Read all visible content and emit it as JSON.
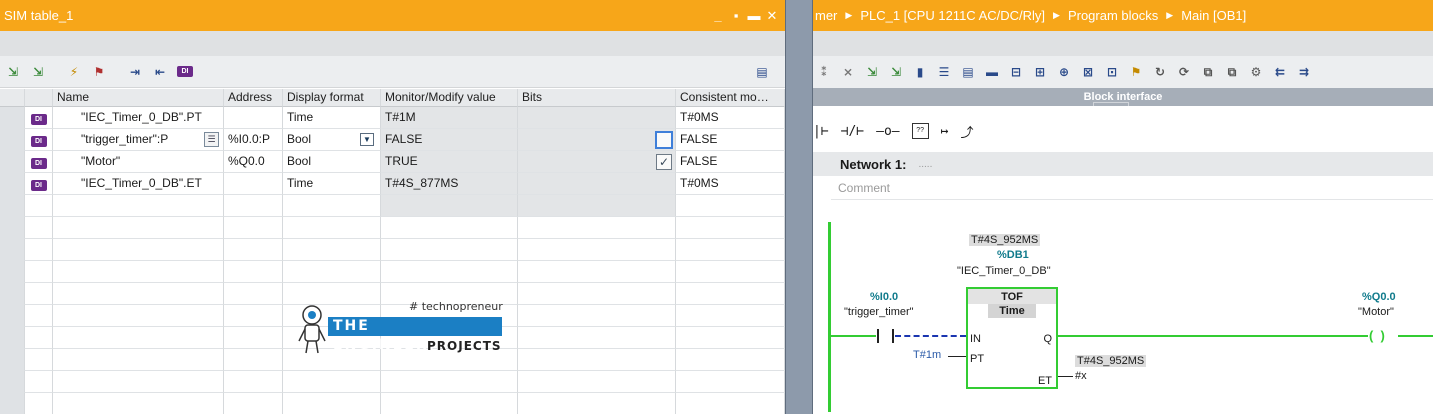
{
  "sim": {
    "title": "SIM table_1",
    "window_controls": [
      "_",
      "▪",
      "▬",
      "✕"
    ],
    "columns": [
      "Name",
      "Address",
      "Display format",
      "Monitor/Modify value",
      "Bits",
      "Consistent mo…"
    ],
    "rows": [
      {
        "name": "\"IEC_Timer_0_DB\".PT",
        "address": "",
        "format": "Time",
        "monitor": "T#1M",
        "bits": "",
        "consistent": "T#0MS"
      },
      {
        "name": "\"trigger_timer\":P",
        "address": "%I0.0:P",
        "format": "Bool",
        "monitor": "FALSE",
        "bits": "",
        "consistent": "FALSE",
        "checkbox": false
      },
      {
        "name": "\"Motor\"",
        "address": "%Q0.0",
        "format": "Bool",
        "monitor": "TRUE",
        "bits": "",
        "consistent": "FALSE",
        "checkbox": true
      },
      {
        "name": "\"IEC_Timer_0_DB\".ET",
        "address": "",
        "format": "Time",
        "monitor": "T#4S_877MS",
        "bits": "",
        "consistent": "T#0MS"
      }
    ],
    "logo": {
      "tagline": "# technopreneur",
      "line1": "THE ENGINEERING",
      "line2": "PROJECTS"
    }
  },
  "prog": {
    "breadcrumb": [
      "mer",
      "PLC_1 [CPU 1211C AC/DC/Rly]",
      "Program blocks",
      "Main [OB1]"
    ],
    "block_interface": "Block interface",
    "network_title": "Network 1:",
    "network_dots": ".....",
    "comment_placeholder": "Comment",
    "timer": {
      "current_value": "T#4S_952MS",
      "db_address": "%DB1",
      "db_name": "\"IEC_Timer_0_DB\"",
      "type": "TOF",
      "subtype": "Time",
      "pin_in": "IN",
      "pin_pt": "PT",
      "pin_q": "Q",
      "pin_et": "ET",
      "pt_value": "T#1m",
      "et_value": "T#4S_952MS",
      "et_target": "#x"
    },
    "input": {
      "address": "%I0.0",
      "name": "\"trigger_timer\""
    },
    "output": {
      "address": "%Q0.0",
      "name": "\"Motor\""
    }
  },
  "colors": {
    "title_orange": "#f7a619",
    "powered_green": "#33cc33",
    "address_teal": "#117b8c",
    "tag_purple": "#6b2a8a"
  }
}
